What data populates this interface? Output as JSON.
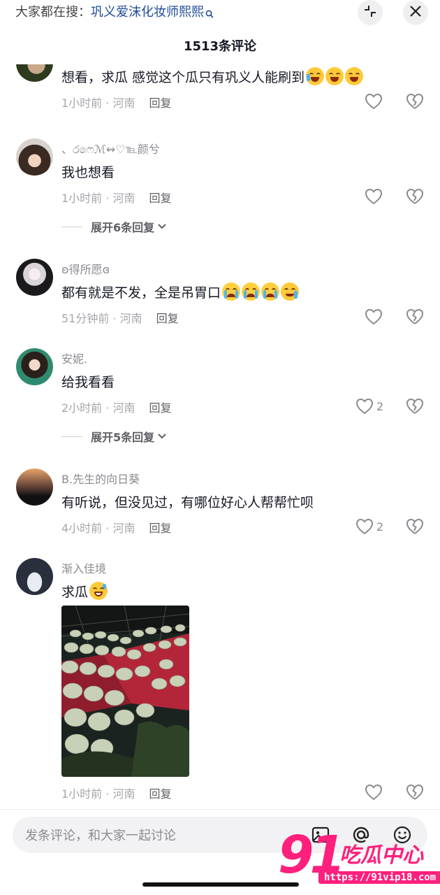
{
  "header": {
    "search_prefix": "大家都在搜：",
    "search_term": "巩义爱沫化妆师熙熙",
    "search_icon": "search-icon",
    "collapse_icon": "collapse-icon",
    "close_icon": "close-icon",
    "comment_count": "1513条评论"
  },
  "comments": [
    {
      "username": "",
      "text": "想看，求瓜 感觉这个瓜只有巩义人能刷到",
      "emojis": [
        "laugh-cry",
        "laugh-cry",
        "laugh-cry"
      ],
      "time": "1小时前 · 河南",
      "reply": "回复",
      "likes": ""
    },
    {
      "username": "、ර෧ෆℳ↭♡℡颜兮",
      "text": "我也想看",
      "time": "1小时前 · 河南",
      "reply": "回复",
      "likes": "",
      "expand": "展开6条回复"
    },
    {
      "username": "ʚ得所愿ɞ",
      "text": "都有就是不发，全是吊胃口",
      "emojis": [
        "sob",
        "sob",
        "sob",
        "cry-smile"
      ],
      "time": "51分钟前 · 河南",
      "reply": "回复",
      "likes": ""
    },
    {
      "username": "安妮.",
      "text": "给我看看",
      "time": "2小时前 · 河南",
      "reply": "回复",
      "likes": "2",
      "expand": "展开5条回复"
    },
    {
      "username": "B.先生的向日葵",
      "text": "有听说，但没见过，有哪位好心人帮帮忙呗",
      "time": "4小时前 · 河南",
      "reply": "回复",
      "likes": "2"
    },
    {
      "username": "渐入佳境",
      "text": "求瓜",
      "emojis": [
        "sweat-grin"
      ],
      "time": "1小时前 · 河南",
      "reply": "回复",
      "likes": "",
      "image": "melon-greenhouse-photo"
    }
  ],
  "input": {
    "placeholder": "发条评论，和大家一起讨论",
    "icons": [
      "image-icon",
      "at-icon",
      "emoji-icon"
    ]
  },
  "watermark": {
    "number": "91",
    "name": "吃瓜中心",
    "url": "https://91vip18.com"
  },
  "colors": {
    "accent_link": "#1f4b99",
    "watermark_pink": "#ff1f7c",
    "muted_text": "#a5a6ab"
  }
}
